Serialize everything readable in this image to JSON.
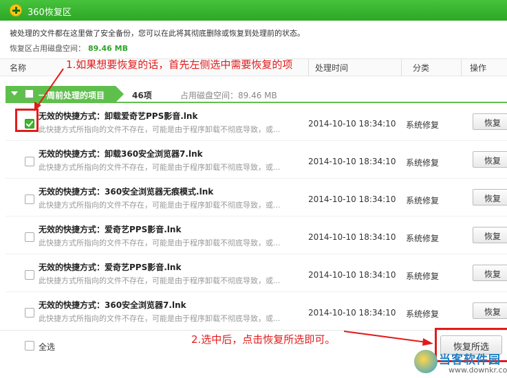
{
  "window": {
    "title": "360恢复区"
  },
  "info": {
    "description": "被处理的文件都在这里做了安全备份，您可以在此将其彻底删除或恢复到处理前的状态。",
    "disk_label": "恢复区占用磁盘空间：",
    "disk_value": "89.46 MB"
  },
  "columns": {
    "name": "名称",
    "time": "处理时间",
    "category": "分类",
    "action": "操作"
  },
  "group": {
    "label": "一周前处理的项目",
    "count": "46项",
    "disk": "占用磁盘空间：89.46 MB"
  },
  "rows": [
    {
      "name": "无效的快捷方式：卸载爱奇艺PPS影音.lnk",
      "desc": "此快捷方式所指向的文件不存在，可能是由于程序卸载不彻底导致，或...",
      "time": "2014-10-10 18:34:10",
      "category": "系统修复",
      "action": "恢复",
      "checked": true
    },
    {
      "name": "无效的快捷方式：卸载360安全浏览器7.lnk",
      "desc": "此快捷方式所指向的文件不存在，可能是由于程序卸载不彻底导致，或...",
      "time": "2014-10-10 18:34:10",
      "category": "系统修复",
      "action": "恢复",
      "checked": false
    },
    {
      "name": "无效的快捷方式：360安全浏览器无痕模式.lnk",
      "desc": "此快捷方式所指向的文件不存在，可能是由于程序卸载不彻底导致，或...",
      "time": "2014-10-10 18:34:10",
      "category": "系统修复",
      "action": "恢复",
      "checked": false
    },
    {
      "name": "无效的快捷方式：爱奇艺PPS影音.lnk",
      "desc": "此快捷方式所指向的文件不存在，可能是由于程序卸载不彻底导致，或...",
      "time": "2014-10-10 18:34:10",
      "category": "系统修复",
      "action": "恢复",
      "checked": false
    },
    {
      "name": "无效的快捷方式：爱奇艺PPS影音.lnk",
      "desc": "此快捷方式所指向的文件不存在，可能是由于程序卸载不彻底导致，或...",
      "time": "2014-10-10 18:34:10",
      "category": "系统修复",
      "action": "恢复",
      "checked": false
    },
    {
      "name": "无效的快捷方式：360安全浏览器7.lnk",
      "desc": "此快捷方式所指向的文件不存在，可能是由于程序卸载不彻底导致，或...",
      "time": "2014-10-10 18:34:10",
      "category": "系统修复",
      "action": "恢复",
      "checked": false
    }
  ],
  "footer": {
    "select_all": "全选",
    "restore_selected": "恢复所选"
  },
  "annotations": {
    "step1": "1.如果想要恢复的话，首先左侧选中需要恢复的项",
    "step2": "2.选中后，点击恢复所选即可。"
  },
  "watermark": {
    "text": "当客软件园",
    "url": "www.downkr.com"
  },
  "colors": {
    "titlebar": "#2da725",
    "accent_green": "#5fbf4d",
    "annotation_red": "#e21b1b"
  }
}
